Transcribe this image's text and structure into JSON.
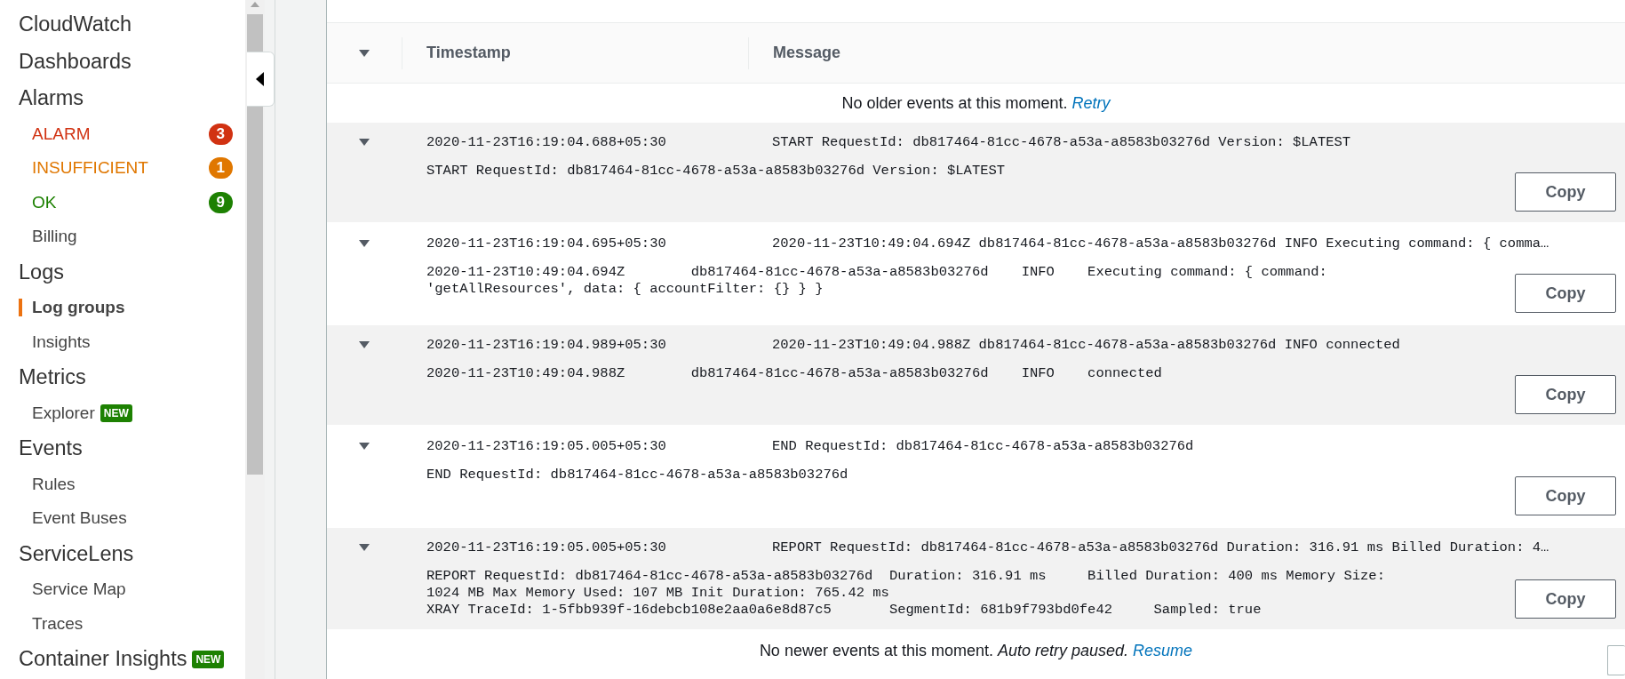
{
  "sidebar": {
    "items": [
      {
        "kind": "section",
        "label": "CloudWatch"
      },
      {
        "kind": "section",
        "label": "Dashboards"
      },
      {
        "kind": "section",
        "label": "Alarms"
      },
      {
        "kind": "status",
        "label": "ALARM",
        "color": "#d13212",
        "badge": "3"
      },
      {
        "kind": "status",
        "label": "INSUFFICIENT",
        "color": "#e07700",
        "badge": "1"
      },
      {
        "kind": "status",
        "label": "OK",
        "color": "#1d8102",
        "badge": "9"
      },
      {
        "kind": "link",
        "label": "Billing",
        "selected": false
      },
      {
        "kind": "section",
        "label": "Logs"
      },
      {
        "kind": "link",
        "label": "Log groups",
        "selected": true
      },
      {
        "kind": "link",
        "label": "Insights",
        "selected": false
      },
      {
        "kind": "section",
        "label": "Metrics"
      },
      {
        "kind": "link",
        "label": "Explorer",
        "selected": false,
        "tag": "NEW"
      },
      {
        "kind": "section",
        "label": "Events"
      },
      {
        "kind": "link",
        "label": "Rules",
        "selected": false
      },
      {
        "kind": "link",
        "label": "Event Buses",
        "selected": false
      },
      {
        "kind": "section",
        "label": "ServiceLens"
      },
      {
        "kind": "link",
        "label": "Service Map",
        "selected": false
      },
      {
        "kind": "link",
        "label": "Traces",
        "selected": false
      },
      {
        "kind": "section",
        "label": "Container Insights",
        "tag": "NEW"
      }
    ]
  },
  "table": {
    "columns": [
      "Timestamp",
      "Message"
    ],
    "top_notice": {
      "text": "No older events at this moment.",
      "link": "Retry"
    },
    "rows": [
      {
        "expanded": true,
        "timestamp": "2020-11-23T16:19:04.688+05:30",
        "message": "START RequestId: db817464-81cc-4678-a53a-a8583b03276d Version: $LATEST",
        "detail": "START RequestId: db817464-81cc-4678-a53a-a8583b03276d Version: $LATEST",
        "button": "Copy"
      },
      {
        "expanded": true,
        "timestamp": "2020-11-23T16:19:04.695+05:30",
        "message": "2020-11-23T10:49:04.694Z db817464-81cc-4678-a53a-a8583b03276d INFO Executing command: { comma…",
        "detail": "2020-11-23T10:49:04.694Z        db817464-81cc-4678-a53a-a8583b03276d    INFO    Executing command: { command:\n'getAllResources', data: { accountFilter: {} } }",
        "button": "Copy"
      },
      {
        "expanded": true,
        "timestamp": "2020-11-23T16:19:04.989+05:30",
        "message": "2020-11-23T10:49:04.988Z db817464-81cc-4678-a53a-a8583b03276d INFO connected",
        "detail": "2020-11-23T10:49:04.988Z        db817464-81cc-4678-a53a-a8583b03276d    INFO    connected",
        "button": "Copy"
      },
      {
        "expanded": true,
        "timestamp": "2020-11-23T16:19:05.005+05:30",
        "message": "END RequestId: db817464-81cc-4678-a53a-a8583b03276d",
        "detail": "END RequestId: db817464-81cc-4678-a53a-a8583b03276d",
        "button": "Copy"
      },
      {
        "expanded": true,
        "timestamp": "2020-11-23T16:19:05.005+05:30",
        "message": "REPORT RequestId: db817464-81cc-4678-a53a-a8583b03276d Duration: 316.91 ms Billed Duration: 4…",
        "detail": "REPORT RequestId: db817464-81cc-4678-a53a-a8583b03276d  Duration: 316.91 ms     Billed Duration: 400 ms Memory Size:\n1024 MB Max Memory Used: 107 MB Init Duration: 765.42 ms\nXRAY TraceId: 1-5fbb939f-16debcb108e2aa0a6e8d87c5       SegmentId: 681b9f793bd0fe42     Sampled: true",
        "button": "Copy"
      }
    ],
    "bottom_notice": {
      "text": "No newer events at this moment.",
      "note": "Auto retry paused.",
      "link": "Resume"
    }
  }
}
